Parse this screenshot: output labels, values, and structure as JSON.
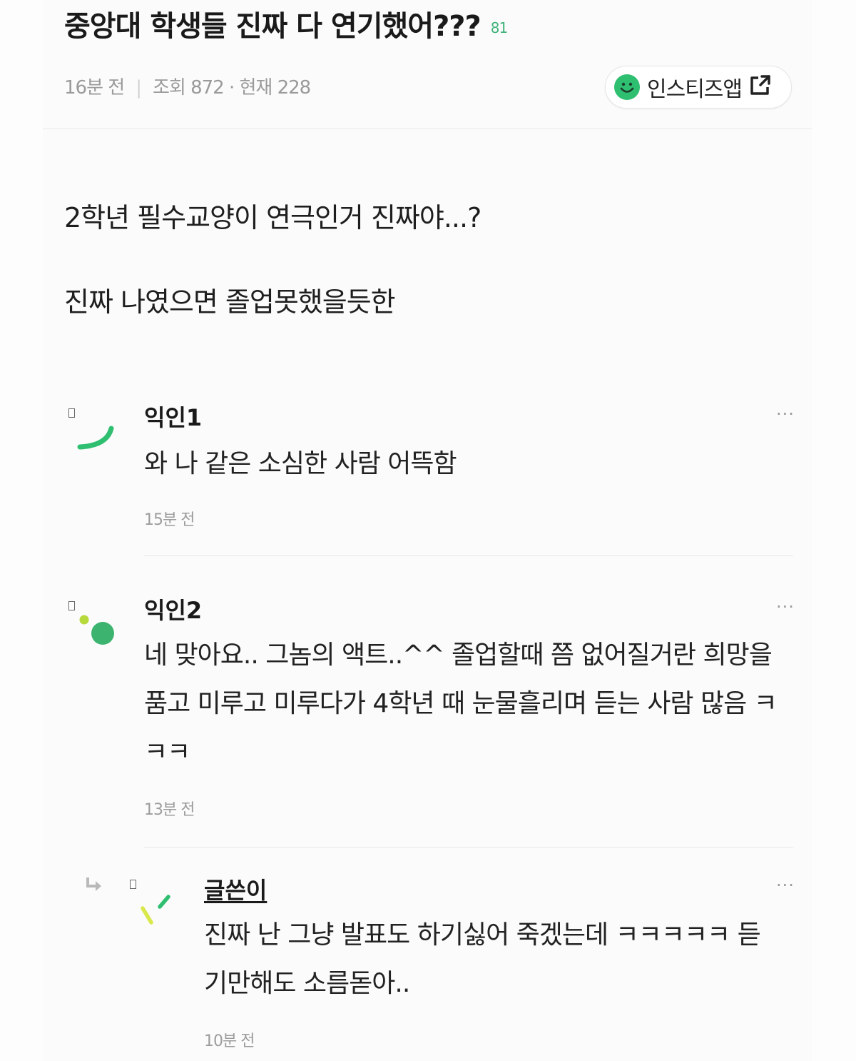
{
  "post": {
    "title": "중앙대 학생들 진짜 다 연기했어???",
    "comment_count": "81",
    "time": "16분 전",
    "views": "조회 872 · 현재 228",
    "app_button_label": "인스티즈앱",
    "body_lines": [
      "2학년 필수교양이 연극인거 진짜야...?",
      "진짜 나였으면 졸업못했을듯한"
    ]
  },
  "comments": [
    {
      "name": "익인1",
      "text": "와 나 같은 소심한 사람 어뜩함",
      "time": "15분 전",
      "more": "···"
    },
    {
      "name": "익인2",
      "text": "네 맞아요.. 그놈의 액트..^^ 졸업할때 쯤 없어질거란 희망을 품고 미루고 미루다가 4학년 때 눈물흘리며 듣는 사람 많음 ㅋㅋㅋ",
      "time": "13분 전",
      "more": "···"
    },
    {
      "name": "글쓴이",
      "text": "진짜 난 그냥 발표도 하기싫어 죽겠는데 ㅋㅋㅋㅋㅋ 듣기만해도 소름돋아..",
      "time": "10분 전",
      "more": "···"
    }
  ],
  "colors": {
    "accent_green": "#2fbf71",
    "count_green": "#41b27a",
    "meta_gray": "#9a9a9a"
  },
  "icons": {
    "app_button": "smile-icon",
    "external": "external-link-icon",
    "reply": "reply-arrow-icon"
  }
}
